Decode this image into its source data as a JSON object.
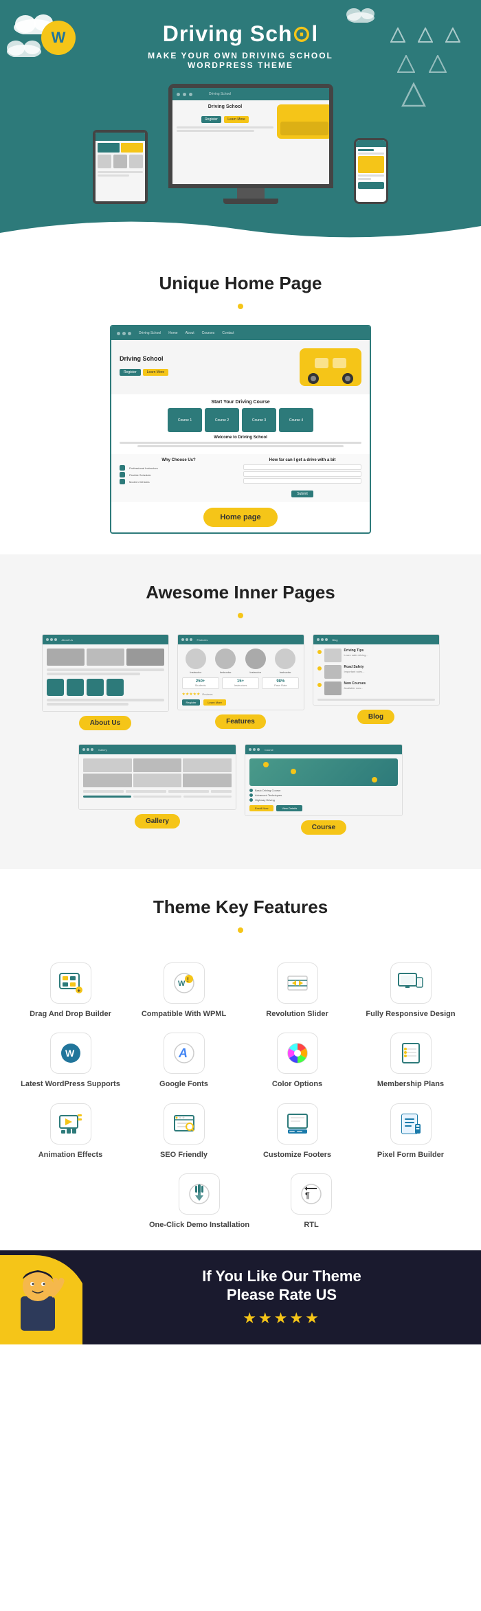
{
  "hero": {
    "title_part1": "Driving Sch",
    "title_part2": "l",
    "subtitle": "MAKE YOUR OWN DRIVING SCHOOL",
    "subtitle2": "WORDPRESS THEME",
    "wp_badge": "W"
  },
  "sections": {
    "unique_home_page": {
      "title": "Unique Home Page",
      "demo_btn": "Home page"
    },
    "awesome_inner_pages": {
      "title": "Awesome Inner Pages",
      "pages": [
        {
          "label": "About Us"
        },
        {
          "label": "Features"
        },
        {
          "label": "Blog"
        },
        {
          "label": "Gallery"
        },
        {
          "label": "Course"
        }
      ]
    },
    "theme_key_features": {
      "title": "Theme Key Features",
      "features": [
        {
          "name": "drag-drop-icon",
          "icon": "🖱️",
          "label": "Drag And Drop Builder"
        },
        {
          "name": "wpml-icon",
          "icon": "🌐",
          "label": "Compatible With WPML"
        },
        {
          "name": "revolution-icon",
          "icon": "↔️",
          "label": "Revolution Slider"
        },
        {
          "name": "responsive-icon",
          "icon": "🖥️",
          "label": "Fully Responsive Design"
        },
        {
          "name": "wordpress-icon",
          "icon": "🔵",
          "label": "Latest WordPress Supports"
        },
        {
          "name": "fonts-icon",
          "icon": "🔤",
          "label": "Google Fonts"
        },
        {
          "name": "color-icon",
          "icon": "🎨",
          "label": "Color Options"
        },
        {
          "name": "membership-icon",
          "icon": "📋",
          "label": "Membership Plans"
        },
        {
          "name": "animation-icon",
          "icon": "▶️",
          "label": "Animation Effects"
        },
        {
          "name": "seo-icon",
          "icon": "🔍",
          "label": "SEO Friendly"
        },
        {
          "name": "footer-icon",
          "icon": "📐",
          "label": "Customize Footers"
        },
        {
          "name": "pixel-icon",
          "icon": "📝",
          "label": "Pixel Form Builder"
        },
        {
          "name": "demo-icon",
          "icon": "👆",
          "label": "One-Click Demo Installation"
        },
        {
          "name": "rtl-icon",
          "icon": "⬅️",
          "label": "RTL"
        }
      ]
    },
    "rate": {
      "line1": "If You Like Our Theme",
      "line2": "Please Rate US",
      "stars": "★★★★★"
    }
  }
}
